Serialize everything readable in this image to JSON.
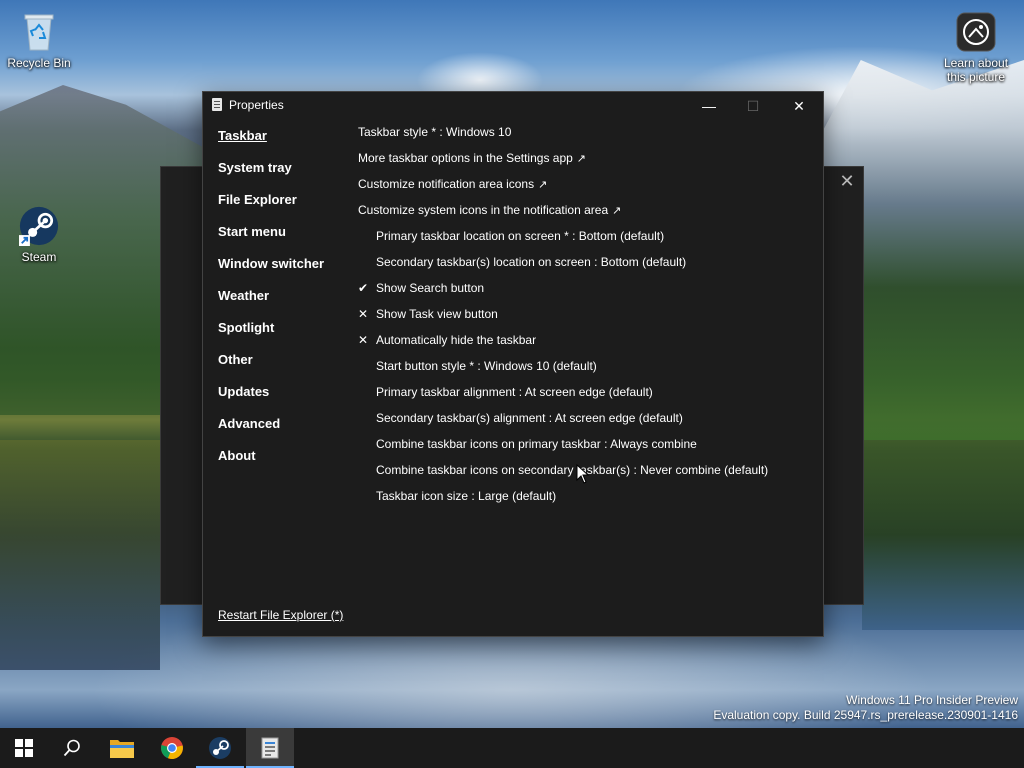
{
  "desktop": {
    "icons": [
      {
        "label": "Recycle Bin",
        "icon": "recycle-bin-icon"
      },
      {
        "label": "Steam",
        "icon": "steam-icon"
      },
      {
        "label": "Learn about this picture",
        "icon": "learn-picture-icon"
      }
    ],
    "watermark": {
      "line1": "Windows 11 Pro Insider Preview",
      "line2": "Evaluation copy. Build 25947.rs_prerelease.230901-1416"
    }
  },
  "back_window": {
    "close_glyph": "✕"
  },
  "window": {
    "title": "Properties",
    "controls": {
      "minimize": "—",
      "maximize": "☐",
      "close": "✕"
    },
    "sidebar": [
      {
        "label": "Taskbar",
        "active": true
      },
      {
        "label": "System tray"
      },
      {
        "label": "File Explorer"
      },
      {
        "label": "Start menu"
      },
      {
        "label": "Window switcher"
      },
      {
        "label": "Weather"
      },
      {
        "label": "Spotlight"
      },
      {
        "label": "Other"
      },
      {
        "label": "Updates"
      },
      {
        "label": "Advanced"
      },
      {
        "label": "About"
      }
    ],
    "options": [
      {
        "label": "Taskbar style * : Windows 10",
        "mark": "",
        "ext": ""
      },
      {
        "label": "More taskbar options in the Settings app",
        "mark": "",
        "ext": "↗"
      },
      {
        "label": "Customize notification area icons",
        "mark": "",
        "ext": "↗"
      },
      {
        "label": "Customize system icons in the notification area",
        "mark": "",
        "ext": "↗"
      },
      {
        "label": "Primary taskbar location on screen * : Bottom (default)",
        "mark": "",
        "ext": ""
      },
      {
        "label": "Secondary taskbar(s) location on screen : Bottom (default)",
        "mark": "",
        "ext": ""
      },
      {
        "label": "Show Search button",
        "mark": "✔",
        "ext": ""
      },
      {
        "label": "Show Task view button",
        "mark": "✕",
        "ext": ""
      },
      {
        "label": "Automatically hide the taskbar",
        "mark": "✕",
        "ext": ""
      },
      {
        "label": "Start button style * : Windows 10 (default)",
        "mark": "",
        "ext": ""
      },
      {
        "label": "Primary taskbar alignment : At screen edge (default)",
        "mark": "",
        "ext": ""
      },
      {
        "label": "Secondary taskbar(s) alignment : At screen edge (default)",
        "mark": "",
        "ext": ""
      },
      {
        "label": "Combine taskbar icons on primary taskbar : Always combine",
        "mark": "",
        "ext": ""
      },
      {
        "label": "Combine taskbar icons on secondary taskbar(s) : Never combine (default)",
        "mark": "",
        "ext": ""
      },
      {
        "label": "Taskbar icon size : Large (default)",
        "mark": "",
        "ext": ""
      }
    ],
    "footer_link": "Restart File Explorer (*)"
  },
  "taskbar": {
    "items": [
      {
        "name": "start",
        "icon": "windows-start-icon"
      },
      {
        "name": "search",
        "icon": "search-icon"
      },
      {
        "name": "file-explorer",
        "icon": "folder-icon"
      },
      {
        "name": "chrome",
        "icon": "chrome-icon"
      },
      {
        "name": "steam",
        "icon": "steam-icon"
      },
      {
        "name": "properties",
        "icon": "properties-app-icon"
      }
    ]
  },
  "colors": {
    "window_bg": "#1c1c1c",
    "taskbar_bg": "#1b1b1b",
    "accent": "#6fb3ff"
  }
}
